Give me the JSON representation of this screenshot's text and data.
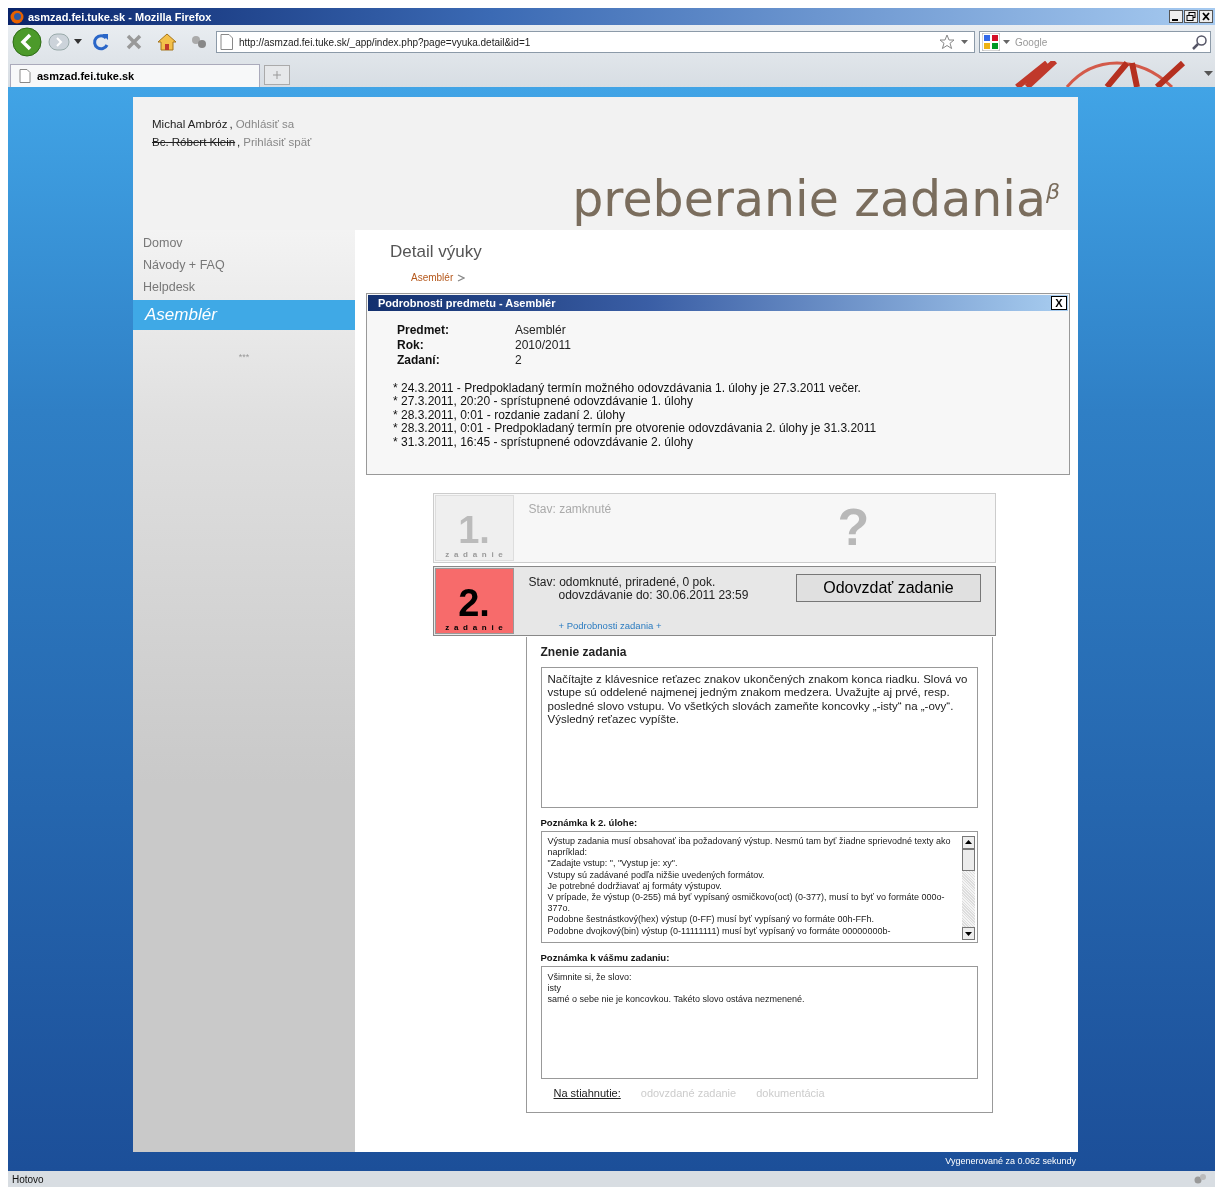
{
  "browser": {
    "title": "asmzad.fei.tuke.sk - Mozilla Firefox",
    "url": "http://asmzad.fei.tuke.sk/_app/index.php?page=vyuka.detail&id=1",
    "search_placeholder": "Google",
    "tabs": [
      {
        "label": "asmzad.fei.tuke.sk",
        "selected": true
      }
    ],
    "status": "Hotovo"
  },
  "header": {
    "users": [
      {
        "name": "Michal Ambróz",
        "separator": ",",
        "action": "Odhlásiť sa",
        "struck": false
      },
      {
        "name": "Bc. Róbert Klein",
        "separator": ",",
        "action": "Prihlásiť späť",
        "struck": true
      }
    ],
    "title": "preberanie zadania$^{β}$"
  },
  "sidebar": {
    "items": [
      {
        "label": "Domov",
        "selected": false
      },
      {
        "label": "Návody + FAQ",
        "selected": false
      },
      {
        "label": "Helpdesk",
        "selected": false
      },
      {
        "label": "Asemblér",
        "selected": true
      }
    ],
    "separator": "***"
  },
  "main": {
    "heading": "Detail výuky",
    "breadcrumb": "Asemblér",
    "subject_panel": {
      "title": "Podrobnosti predmetu - Asemblér",
      "close": "X",
      "fields": [
        {
          "label": "Predmet:",
          "value": "Asemblér"
        },
        {
          "label": "Rok:",
          "value": "2010/2011"
        },
        {
          "label": "Zadaní:",
          "value": "2"
        }
      ],
      "notes": [
        "* 24.3.2011 - Predpokladaný termín možného odovzdávania 1. úlohy je 27.3.2011 večer.",
        "* 27.3.2011, 20:20 - sprístupnené odovzdávanie 1. úlohy",
        "* 28.3.2011, 0:01 - rozdanie zadaní 2. úlohy",
        "* 28.3.2011, 0:01 - Predpokladaný termín pre otvorenie odovzdávania 2. úlohy je 31.3.2011",
        "* 31.3.2011, 16:45 - sprístupnené odovzdávanie 2. úlohy"
      ]
    },
    "assignments": [
      {
        "number": "1.",
        "word": "zadanie",
        "locked": true,
        "status": "Stav: zamknuté",
        "mark": "?"
      },
      {
        "number": "2.",
        "word": "zadanie",
        "locked": false,
        "status": "Stav: odomknuté, priradené, 0 pok.",
        "deadline": "odovzdávanie do: 30.06.2011 23:59",
        "button": "Odovzdať zadanie",
        "details_link": "+ Podrobnosti zadania +"
      }
    ],
    "details": {
      "heading": "Znenie zadania",
      "text": "Načítajte z klávesnice reťazec znakov ukončených znakom konca riadku. Slová vo vstupe sú oddelené najmenej jedným znakom medzera. Uvažujte aj prvé, resp. posledné slovo vstupu. Vo všetkých slovách zameňte koncovky „-isty“ na „-ovy“. Výsledný reťazec vypíšte.",
      "note_label": "Poznámka k 2. úlohe:",
      "note_lines": [
        "Výstup zadania musí obsahovať iba požadovaný výstup. Nesmú tam byť žiadne sprievodné texty ako napríklad:",
        "\"Zadajte vstup: \", \"Vystup je: xy\".",
        "Vstupy sú zadávané podľa nižšie uvedených formátov.",
        "Je potrebné dodržiavať aj formáty výstupov.",
        "V prípade, že výstup (0-255) má byť vypísaný osmičkovo(oct) (0-377), musí to byť vo formáte 000o-377o.",
        "Podobne šestnástkový(hex) výstup (0-FF) musí byť vypísaný vo formáte 00h-FFh.",
        "Podobne dvojkový(bin) výstup (0-11111111) musí byť vypísaný vo formáte 00000000b-"
      ],
      "personal_label": "Poznámka k vášmu zadaniu:",
      "personal_lines": [
        "Všimnite si, že slovo:",
        "isty",
        "samé o sebe nie je koncovkou. Takéto slovo ostáva nezmenené."
      ],
      "downloads_label": "Na stiahnutie:",
      "downloads": [
        {
          "label": "odovzdané zadanie",
          "disabled": true
        },
        {
          "label": "dokumentácia",
          "disabled": true
        }
      ]
    }
  },
  "footer": "Vygenerované za 0.062 sekundy"
}
